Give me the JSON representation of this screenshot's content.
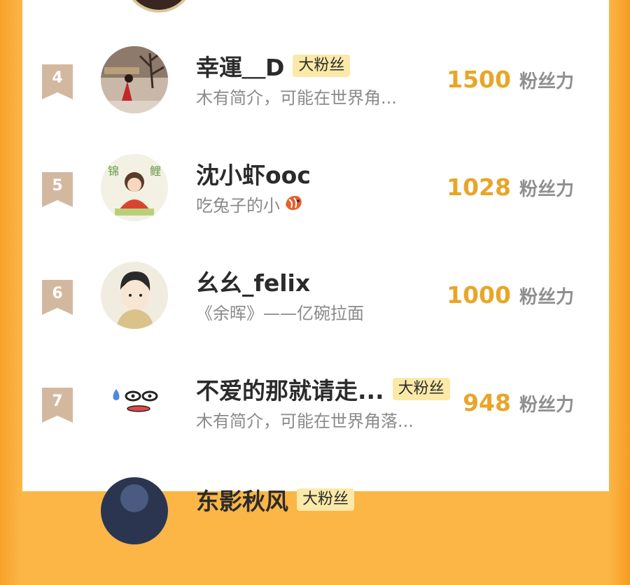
{
  "unit_label": "粉丝力",
  "badge_label": "大粉丝",
  "entries": [
    {
      "rank": "4",
      "name": "幸運＿D",
      "badge": "大粉丝",
      "bio": "木有简介，可能在世界角...",
      "score": "1500"
    },
    {
      "rank": "5",
      "name": "沈小虾ooc",
      "badge": "",
      "bio": "吃兔子的小",
      "score": "1028",
      "bio_icon": "shrimp-emoji-icon"
    },
    {
      "rank": "6",
      "name": "幺幺_felix",
      "badge": "",
      "bio": "《余晖》——亿碗拉面",
      "score": "1000"
    },
    {
      "rank": "7",
      "name": "不爱的那就请走...",
      "badge": "大粉丝",
      "bio": "木有简介，可能在世界角落...",
      "score": "948"
    },
    {
      "rank": "",
      "name": "东影秋风",
      "badge": "大粉丝",
      "bio": "",
      "score": ""
    }
  ],
  "colors": {
    "accent_orange": "#f7a12a",
    "score_color": "#e9a528",
    "rank_tag": "#d3b8a0",
    "badge_bg": "#fbe9a8"
  }
}
